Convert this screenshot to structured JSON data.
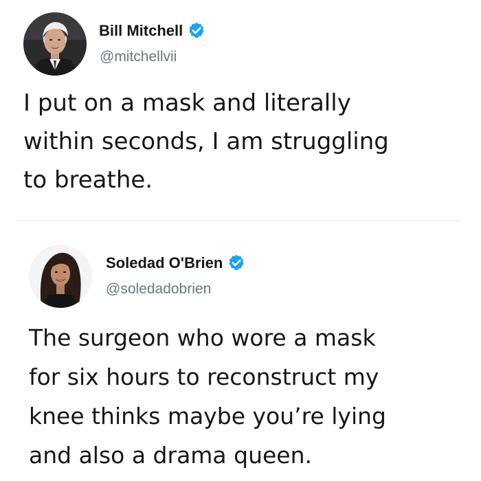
{
  "tweets": [
    {
      "author": {
        "name": "Bill Mitchell",
        "handle": "@mitchellvii",
        "verified": true
      },
      "text_lines": [
        "I put on a mask and literally",
        "within seconds, I am struggling",
        "to breathe."
      ]
    },
    {
      "author": {
        "name": "Soledad O'Brien",
        "handle": "@soledadobrien",
        "verified": true
      },
      "text_lines": [
        "The surgeon who wore a mask",
        "for six hours to reconstruct my",
        "knee thinks maybe you’re lying",
        "and also a drama queen."
      ]
    }
  ],
  "colors": {
    "name": "#14171a",
    "handle": "#657786",
    "verified": "#1da1f2",
    "divider": "#e1e8ed"
  },
  "icons": {
    "verified": "verified-badge-icon"
  }
}
